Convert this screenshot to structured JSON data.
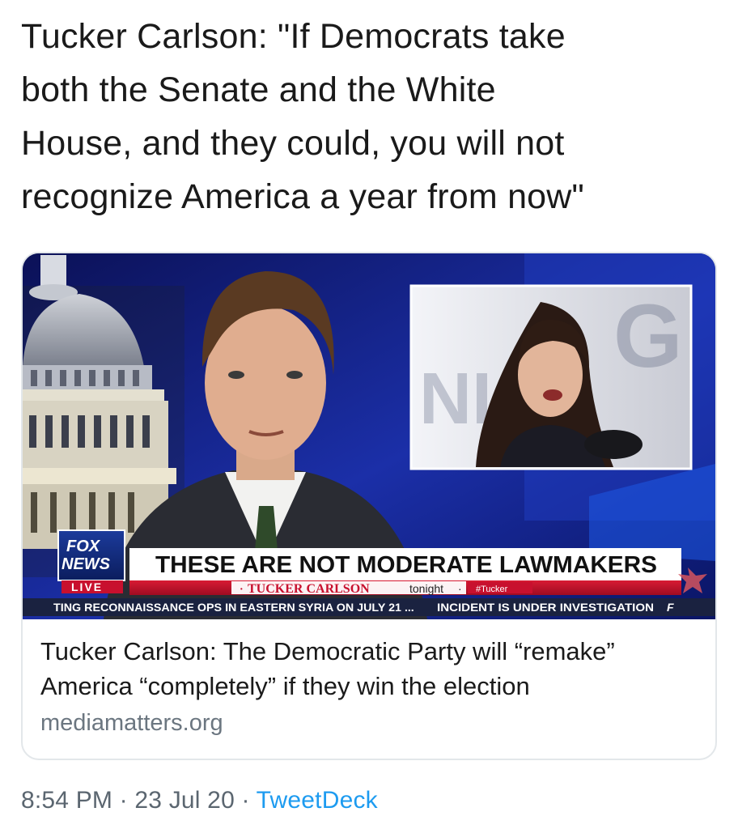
{
  "tweet": {
    "text": "Tucker Carlson: \"If Democrats take\nboth the Senate and the White\nHouse, and they could, you will not\nrecognize America a year from now\""
  },
  "card": {
    "broadcast": {
      "network_logo_line1": "FOX",
      "network_logo_line2": "NEWS",
      "live_badge": "LIVE",
      "headline": "THESE ARE NOT MODERATE LAWMAKERS",
      "show_bullet_left": "·",
      "show_name": "TUCKER CARLSON",
      "show_suffix": "tonight",
      "show_bullet_right": "·",
      "hashtag": "#Tucker",
      "ticker_left": "TING RECONNAISSANCE OPS IN EASTERN SYRIA ON JULY 21",
      "ticker_sep": "...",
      "ticker_right": "INCIDENT IS UNDER INVESTIGATION",
      "ticker_logo": "F",
      "inset_bg_letters_left": "NI",
      "inset_bg_letters_right": "G"
    },
    "title": "Tucker Carlson: The Democratic Party will “remake”\nAmerica “completely” if they win the election",
    "domain": "mediamatters.org"
  },
  "meta": {
    "time": "8:54 PM",
    "sep1": " · ",
    "date": "23 Jul 20",
    "sep2": " · ",
    "source": "TweetDeck"
  },
  "colors": {
    "studio_blue": "#1a2a9a",
    "lower_third_red": "#c8102e",
    "link_blue": "#1d9bf0",
    "muted_gray": "#6b7680"
  }
}
